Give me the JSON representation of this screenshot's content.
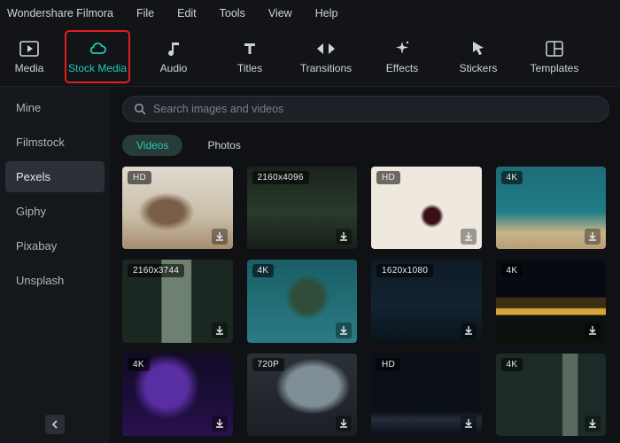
{
  "app": {
    "title": "Wondershare Filmora"
  },
  "menu": {
    "file": "File",
    "edit": "Edit",
    "tools": "Tools",
    "view": "View",
    "help": "Help"
  },
  "toolbar": {
    "media": "Media",
    "stock": "Stock Media",
    "audio": "Audio",
    "titles": "Titles",
    "transitions": "Transitions",
    "effects": "Effects",
    "stickers": "Stickers",
    "templates": "Templates"
  },
  "sidebar": {
    "items": [
      {
        "label": "Mine"
      },
      {
        "label": "Filmstock"
      },
      {
        "label": "Pexels"
      },
      {
        "label": "Giphy"
      },
      {
        "label": "Pixabay"
      },
      {
        "label": "Unsplash"
      }
    ]
  },
  "search": {
    "placeholder": "Search images and videos"
  },
  "tabs": {
    "videos": "Videos",
    "photos": "Photos"
  },
  "cards": [
    {
      "badge": "HD"
    },
    {
      "badge": "2160x4096"
    },
    {
      "badge": "HD"
    },
    {
      "badge": "4K"
    },
    {
      "badge": "2160x3744"
    },
    {
      "badge": "4K"
    },
    {
      "badge": "1620x1080"
    },
    {
      "badge": "4K"
    },
    {
      "badge": "4K"
    },
    {
      "badge": "720P"
    },
    {
      "badge": "HD"
    },
    {
      "badge": "4K"
    }
  ]
}
